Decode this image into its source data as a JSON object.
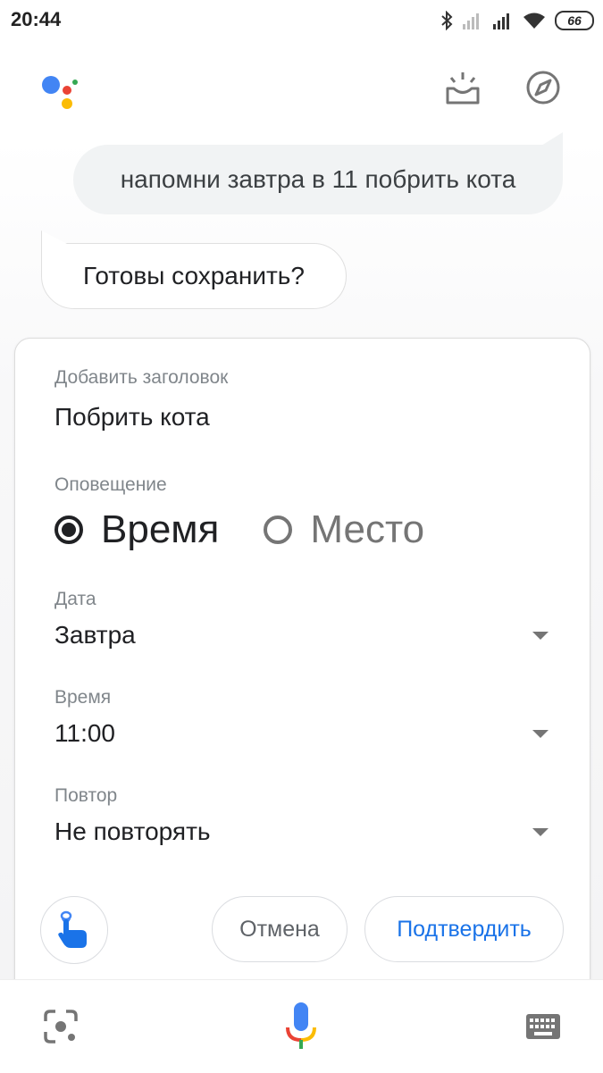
{
  "status_bar": {
    "time": "20:44",
    "battery": "66",
    "icons": [
      "bluetooth-icon",
      "signal-icon",
      "signal-icon",
      "wifi-icon",
      "battery-icon"
    ]
  },
  "header": {
    "logo": "google-assistant-logo",
    "actions": [
      "snapshot-icon",
      "explore-icon"
    ]
  },
  "conversation": {
    "user_message": "напомни завтра в 11 побрить кота",
    "assistant_message": "Готовы сохранить?"
  },
  "reminder_card": {
    "title_label": "Добавить заголовок",
    "title_value": "Побрить кота",
    "notify_label": "Оповещение",
    "notify_options": [
      {
        "label": "Время",
        "selected": true
      },
      {
        "label": "Место",
        "selected": false
      }
    ],
    "date_label": "Дата",
    "date_value": "Завтра",
    "time_label": "Время",
    "time_value": "11:00",
    "repeat_label": "Повтор",
    "repeat_value": "Не повторять",
    "cancel_label": "Отмена",
    "confirm_label": "Подтвердить"
  },
  "bottom_bar": {
    "icons": [
      "lens-icon",
      "mic-icon",
      "keyboard-icon"
    ]
  },
  "colors": {
    "google_blue": "#4285F4",
    "google_red": "#EA4335",
    "google_yellow": "#FBBC05",
    "google_green": "#34A853",
    "confirm_text": "#1a73e8"
  }
}
